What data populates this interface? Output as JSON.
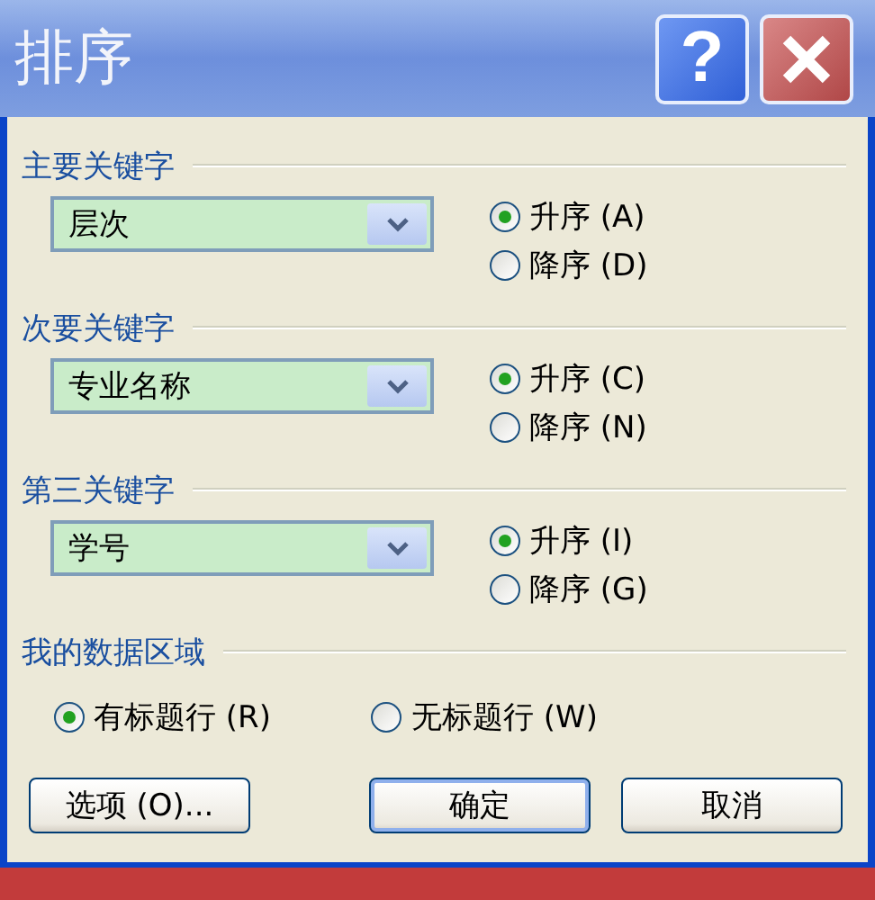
{
  "window": {
    "title": "排序",
    "help": "?"
  },
  "sort_keys": [
    {
      "heading": "主要关键字",
      "field": {
        "value": "层次"
      },
      "options": [
        {
          "label": "升序 (A)",
          "selected": true
        },
        {
          "label": "降序 (D)",
          "selected": false
        }
      ]
    },
    {
      "heading": "次要关键字",
      "field": {
        "value": "专业名称"
      },
      "options": [
        {
          "label": "升序 (C)",
          "selected": true
        },
        {
          "label": "降序 (N)",
          "selected": false
        }
      ]
    },
    {
      "heading": "第三关键字",
      "field": {
        "value": "学号"
      },
      "options": [
        {
          "label": "升序 (I)",
          "selected": true
        },
        {
          "label": "降序 (G)",
          "selected": false
        }
      ]
    }
  ],
  "data_range": {
    "heading": "我的数据区域",
    "options": [
      {
        "label": "有标题行 (R)",
        "selected": true
      },
      {
        "label": "无标题行 (W)",
        "selected": false
      }
    ]
  },
  "buttons": [
    {
      "label": "选项 (O)...",
      "default": false
    },
    {
      "label": "确定",
      "default": true
    },
    {
      "label": "取消",
      "default": false
    }
  ]
}
